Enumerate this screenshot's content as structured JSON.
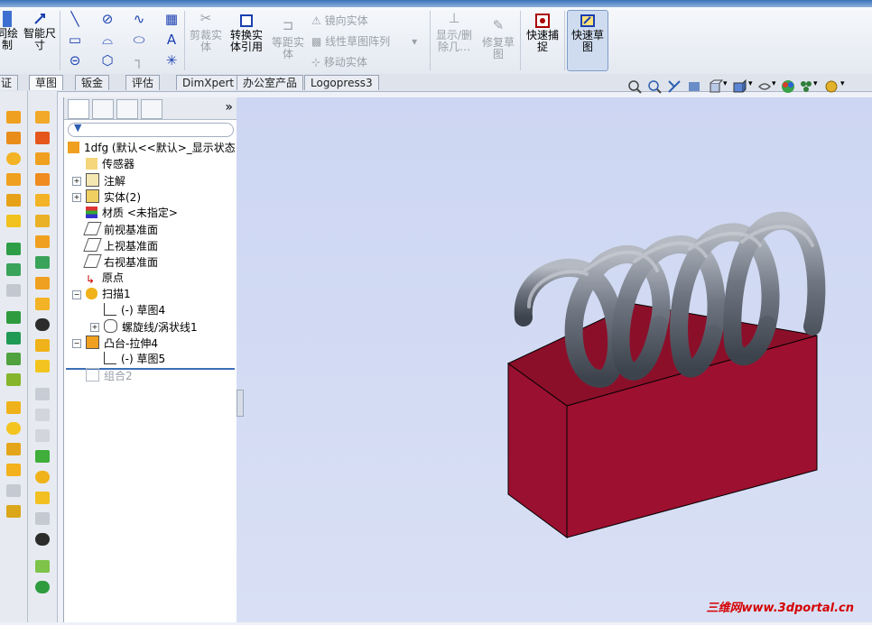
{
  "ribbon": {
    "btn_edge_label": "同绘\n制",
    "smart_dim_label": "智能尺\n寸",
    "trim_label": "剪裁实\n体",
    "convert_label": "转换实\n体引用",
    "offset_label": "等距实\n体",
    "mirror_label": "镜向实体",
    "linear_pattern_label": "线性草图阵列",
    "move_label": "移动实体",
    "show_delete_label": "显示/删\n除几…",
    "repair_label": "修复草\n图",
    "quick_snap_label": "快速捕\n捉",
    "quick_sketch_label": "快速草\n图"
  },
  "tabs": [
    "证",
    "草图",
    "钣金",
    "评估",
    "DimXpert",
    "办公室产品",
    "Logopress3"
  ],
  "tree": {
    "root": "1dfg  (默认<<默认>_显示状态",
    "items": [
      {
        "label": "传感器"
      },
      {
        "label": "注解"
      },
      {
        "label": "实体(2)"
      },
      {
        "label": "材质 <未指定>"
      },
      {
        "label": "前视基准面"
      },
      {
        "label": "上视基准面"
      },
      {
        "label": "右视基准面"
      },
      {
        "label": "原点"
      },
      {
        "label": "扫描1"
      },
      {
        "label": "(-) 草图4"
      },
      {
        "label": "螺旋线/涡状线1"
      },
      {
        "label": "凸台-拉伸4"
      },
      {
        "label": "(-) 草图5"
      },
      {
        "label": "组合2"
      }
    ]
  },
  "colors": {
    "block": "#8c0f2a",
    "spring": "#6f7682",
    "viewport": "#d2daf3"
  },
  "watermark": "三维网www.3dportal.cn"
}
